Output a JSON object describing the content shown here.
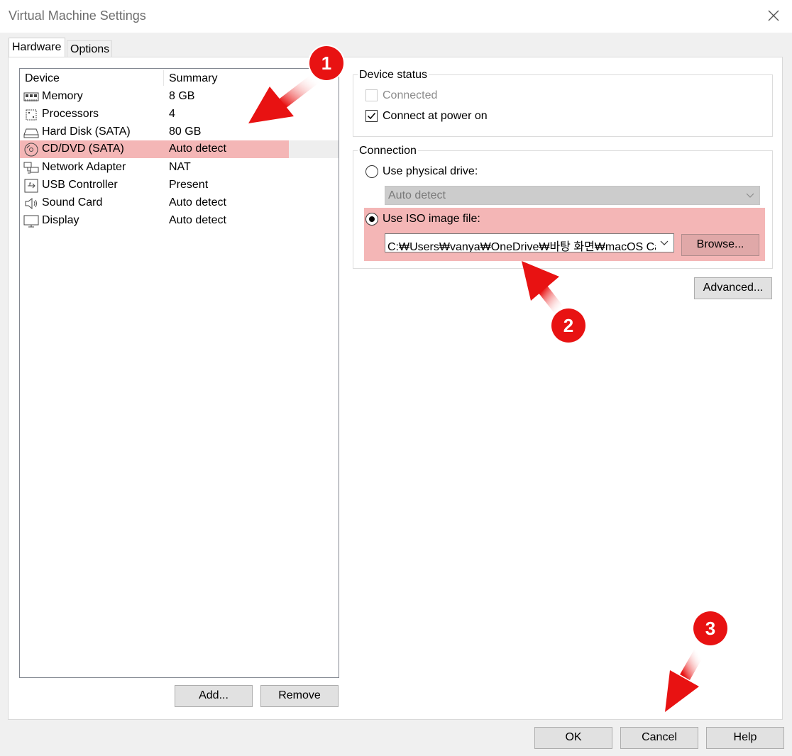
{
  "window": {
    "title": "Virtual Machine Settings"
  },
  "tabs": [
    {
      "label": "Hardware",
      "active": true
    },
    {
      "label": "Options",
      "active": false
    }
  ],
  "device_list": {
    "headers": {
      "device": "Device",
      "summary": "Summary"
    },
    "rows": [
      {
        "icon": "memory-icon",
        "device": "Memory",
        "summary": "8 GB",
        "selected": false
      },
      {
        "icon": "processor-icon",
        "device": "Processors",
        "summary": "4",
        "selected": false
      },
      {
        "icon": "hard-disk-icon",
        "device": "Hard Disk (SATA)",
        "summary": "80 GB",
        "selected": false
      },
      {
        "icon": "cd-dvd-icon",
        "device": "CD/DVD (SATA)",
        "summary": "Auto detect",
        "selected": true
      },
      {
        "icon": "network-adapter-icon",
        "device": "Network Adapter",
        "summary": "NAT",
        "selected": false
      },
      {
        "icon": "usb-icon",
        "device": "USB Controller",
        "summary": "Present",
        "selected": false
      },
      {
        "icon": "sound-icon",
        "device": "Sound Card",
        "summary": "Auto detect",
        "selected": false
      },
      {
        "icon": "display-icon",
        "device": "Display",
        "summary": "Auto detect",
        "selected": false
      }
    ],
    "add_label": "Add...",
    "remove_label": "Remove"
  },
  "device_status": {
    "group_label": "Device status",
    "connected_label": "Connected",
    "connected_checked": false,
    "connected_enabled": false,
    "power_on_label": "Connect at power on",
    "power_on_checked": true
  },
  "connection": {
    "group_label": "Connection",
    "physical_label": "Use physical drive:",
    "physical_selected": false,
    "physical_value": "Auto detect",
    "iso_label": "Use ISO image file:",
    "iso_selected": true,
    "iso_path": "C:₩Users₩vanya₩OneDrive₩바탕 화면₩macOS Cata",
    "browse_label": "Browse..."
  },
  "advanced_label": "Advanced...",
  "footer": {
    "ok_label": "OK",
    "cancel_label": "Cancel",
    "help_label": "Help"
  },
  "annotations": [
    "1",
    "2",
    "3"
  ],
  "colors": {
    "highlight": "#f4b6b6",
    "badge": "#e81212"
  }
}
